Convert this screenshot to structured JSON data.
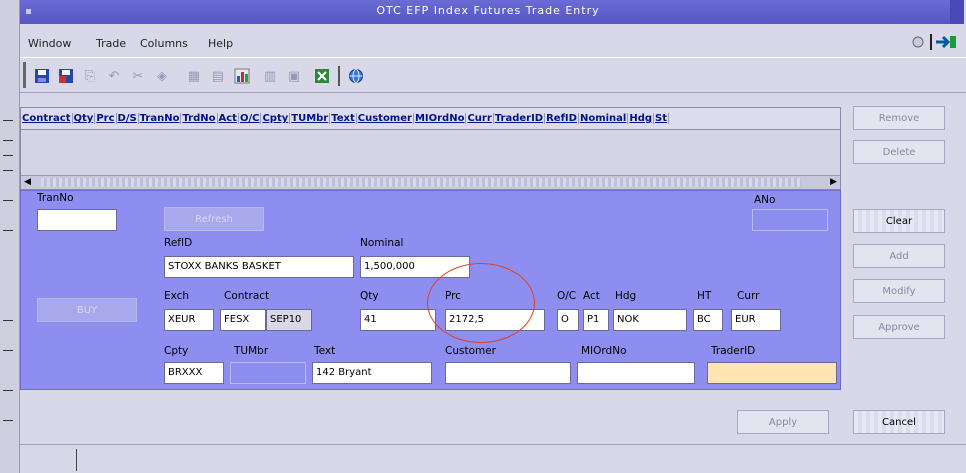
{
  "window": {
    "title": "OTC EFP Index Futures Trade Entry"
  },
  "menu": {
    "items": [
      "Window",
      "Trade",
      "Columns",
      "Help"
    ]
  },
  "toolbar": {
    "icons": [
      "save-icon",
      "save-all-icon",
      "copy-icon",
      "undo-icon",
      "cut-icon",
      "paste-icon",
      "grid-icon",
      "filter-icon",
      "chart-icon",
      "table-icon",
      "print-icon",
      "excel-icon",
      "globe-icon"
    ]
  },
  "table": {
    "columns": [
      "Contract",
      "Qty",
      "Prc",
      "D/S",
      "TranNo",
      "TrdNo",
      "Act",
      "O/C",
      "Cpty",
      "TUMbr",
      "Text",
      "Customer",
      "MIOrdNo",
      "Curr",
      "TraderID",
      "RefID",
      "Nominal",
      "Hdg",
      "St"
    ]
  },
  "side_buttons": {
    "remove": "Remove",
    "delete": "Delete",
    "clear": "Clear",
    "add": "Add",
    "modify": "Modify",
    "approve": "Approve"
  },
  "form": {
    "tranno_label": "TranNo",
    "ano_label": "ANo",
    "tranno_value": "",
    "refresh_button": "Refresh",
    "ref_id_label": "RefID",
    "ref_id_value": "STOXX BANKS BASKET",
    "nominal_label": "Nominal",
    "nominal_value": "1,500,000",
    "buy_button": "BUY",
    "exch_label": "Exch",
    "exch_value": "XEUR",
    "contract_label": "Contract",
    "contract_prefix": "FESX",
    "contract_value": "SEP10",
    "qty_label": "Qty",
    "qty_value": "41",
    "prc_label": "Prc",
    "prc_value": "2172,5",
    "oc_label": "O/C",
    "oc_value": "O",
    "act_label": "Act",
    "act_value": "P1",
    "hdg_label": "Hdg",
    "hdg_value": "NOK",
    "ht_label": "HT",
    "ht_value": "BC",
    "curr_label": "Curr",
    "curr_value": "EUR",
    "cpty_label": "Cpty",
    "cpty_value": "BRXXX",
    "tumbr_label": "TUMbr",
    "tumbr_value": "",
    "text_label": "Text",
    "text_value": "142 Bryant",
    "customer_label": "Customer",
    "customer_value": "",
    "miordno_label": "MIOrdNo",
    "miordno_value": "",
    "traderid_label": "TraderID",
    "traderid_value": ""
  },
  "bottom": {
    "apply_button": "Apply",
    "cancel_button": "Cancel"
  },
  "colors": {
    "title": "#5656c4",
    "form_bg": "#8e8ef0",
    "highlight_circle": "#e04020",
    "trader_field": "#fde4b0"
  }
}
